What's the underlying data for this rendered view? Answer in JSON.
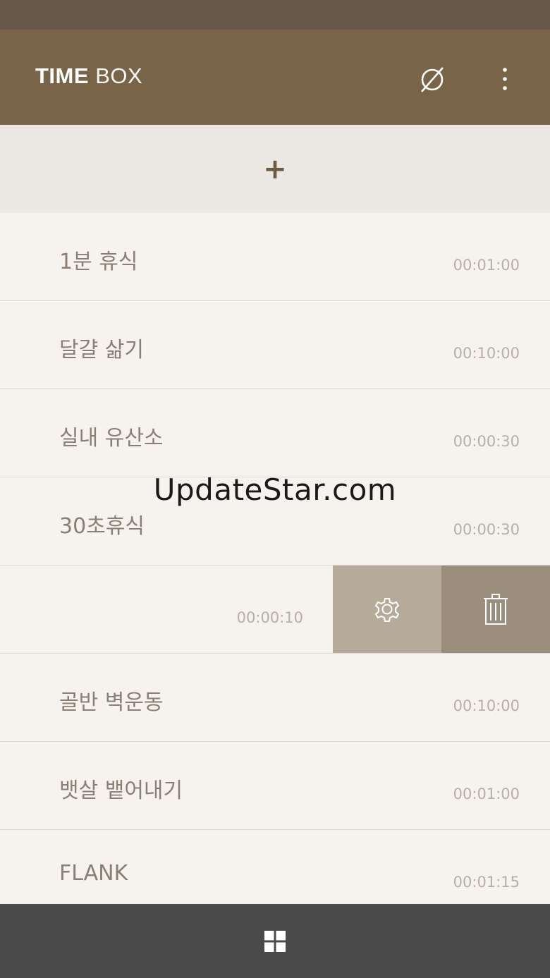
{
  "app_bar": {
    "title_bold": "TIME",
    "title_light": "BOX",
    "timer_off_icon": "empty-set-icon",
    "more_icon": "more-vertical-icon"
  },
  "add_bar": {
    "plus": "+"
  },
  "list": {
    "items": [
      {
        "name": "1분 휴식",
        "time": "00:01:00"
      },
      {
        "name": "달걀 삶기",
        "time": "00:10:00"
      },
      {
        "name": "실내 유산소",
        "time": "00:00:30"
      },
      {
        "name": "30초휴식",
        "time": "00:00:30"
      },
      {
        "name": "",
        "time": "00:00:10",
        "swiped": true
      },
      {
        "name": "골반 벽운동",
        "time": "00:10:00"
      },
      {
        "name": "뱃살 뱉어내기",
        "time": "00:01:00"
      },
      {
        "name": "FLANK",
        "time": "00:01:15"
      }
    ]
  },
  "swipe_actions": {
    "settings_icon": "gear-icon",
    "delete_icon": "trash-icon",
    "settings_color": "#b6ab9a",
    "delete_color": "#9c8e7d"
  },
  "bottom_bar": {
    "windows_icon": "windows-logo-icon"
  },
  "watermark": {
    "text": "UpdateStar.com"
  },
  "colors": {
    "app_bar": "#7a6447",
    "status_bar": "#665848",
    "list_bg": "#f6f3ee",
    "bottom_bar": "#4a4a4a"
  }
}
